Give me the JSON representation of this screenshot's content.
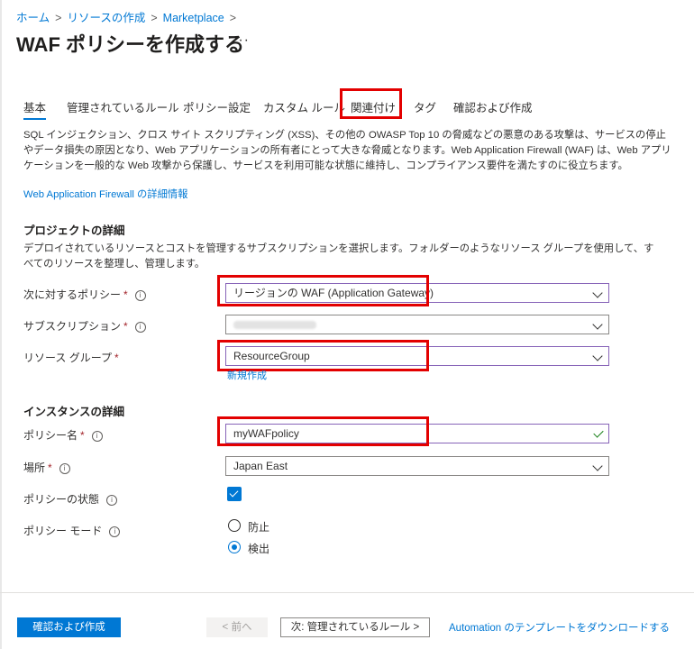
{
  "breadcrumb": {
    "items": [
      "ホーム",
      "リソースの作成",
      "Marketplace"
    ],
    "sep": ">"
  },
  "page": {
    "title": "WAF ポリシーを作成する",
    "more": "···"
  },
  "tabs": [
    "基本",
    "管理されているルール",
    "ポリシー設定",
    "カスタム ルール",
    "関連付け",
    "タグ",
    "確認および作成"
  ],
  "intro": {
    "text": "SQL インジェクション、クロス サイト スクリプティング (XSS)、その他の OWASP Top 10 の脅威などの悪意のある攻撃は、サービスの停止やデータ損失の原因となり、Web アプリケーションの所有者にとって大きな脅威となります。Web Application Firewall (WAF) は、Web アプリケーションを一般的な Web 攻撃から保護し、サービスを利用可能な状態に維持し、コンプライアンス要件を満たすのに役立ちます。",
    "link": "Web Application Firewall の詳細情報"
  },
  "project": {
    "heading": "プロジェクトの詳細",
    "description": "デプロイされているリソースとコストを管理するサブスクリプションを選択します。フォルダーのようなリソース グループを使用して、すべてのリソースを整理し、管理します。",
    "policy_for_label": "次に対するポリシー",
    "policy_for_value": "リージョンの WAF (Application Gateway)",
    "subscription_label": "サブスクリプション",
    "rg_label": "リソース グループ",
    "rg_value": "ResourceGroup",
    "new_link": "新規作成"
  },
  "instance": {
    "heading": "インスタンスの詳細",
    "name_label": "ポリシー名",
    "name_value": "myWAFpolicy",
    "location_label": "場所",
    "location_value": "Japan East",
    "state_label": "ポリシーの状態",
    "state_checked": true,
    "mode_label": "ポリシー モード",
    "mode_options": [
      "防止",
      "検出"
    ],
    "mode_selected": "検出"
  },
  "common": {
    "required": "*",
    "info": "i"
  },
  "footer": {
    "review_create": "確認および作成",
    "prev": "< 前へ",
    "next": "次: 管理されているルール >",
    "download": "Automation のテンプレートをダウンロードする"
  },
  "colors": {
    "accent": "#0078d4",
    "highlight": "#e30000",
    "required": "#a4262c",
    "valid": "#107c10"
  }
}
